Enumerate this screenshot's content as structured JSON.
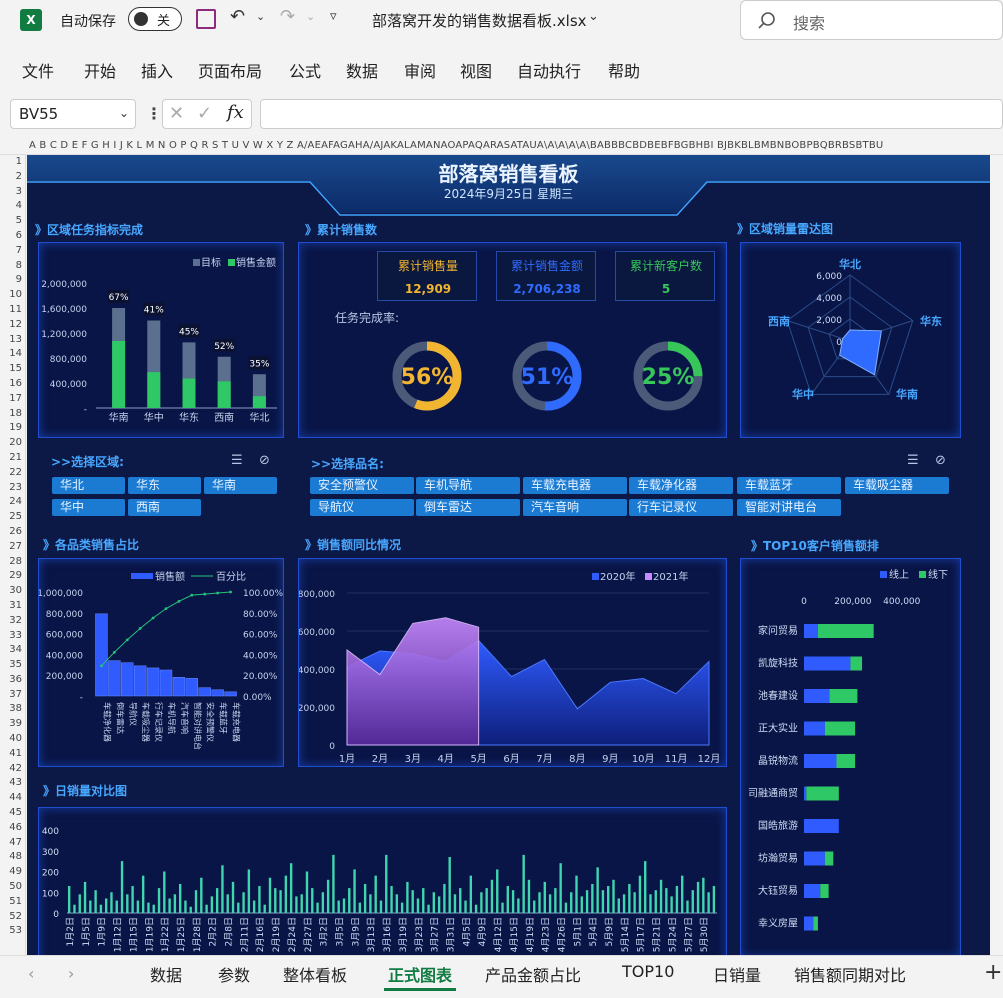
{
  "app": {
    "autosave_label": "自动保存",
    "autosave_state": "关",
    "filename": "部落窝开发的销售数据看板.xlsx",
    "search_placeholder": "搜索"
  },
  "menu": [
    "文件",
    "开始",
    "插入",
    "页面布局",
    "公式",
    "数据",
    "审阅",
    "视图",
    "自动执行",
    "帮助"
  ],
  "formula_bar": {
    "name_box": "BV55",
    "fx": "fx",
    "content": ""
  },
  "col_headers": "A B C D E F G H I J K L M N O P Q R S T U V W X Y Z A/AEAFAGAHA/AJAKALAMANAOAPAQARASATAUA\\A\\A\\A\\A\\BABBBCBDBEBFBGBHBI BJBKBLBMBNBOBPBQBRBSBTBU",
  "row_count": 53,
  "dashboard": {
    "title": "部落窝销售看板",
    "date": "2024年9月25日 星期三",
    "sections": {
      "region_task": "》区域任务指标完成",
      "cumulative": "》累计销售数",
      "radar": "》区域销量雷达图",
      "category_share": "》各品类销售占比",
      "yoy": "》销售额同比情况",
      "top10": "》TOP10客户销售额排",
      "daily": "》日销量对比图"
    },
    "kpis": [
      {
        "label": "累计销售量",
        "value": "12,909",
        "color": "#f2b531"
      },
      {
        "label": "累计销售金额",
        "value": "2,706,238",
        "color": "#2f6bff"
      },
      {
        "label": "累计新客户数",
        "value": "5",
        "color": "#36c65a"
      }
    ],
    "completion_label": "任务完成率:",
    "gauges": [
      {
        "text": "56%",
        "value": 56,
        "color": "#f2b531"
      },
      {
        "text": "51%",
        "value": 51,
        "color": "#2f6bff"
      },
      {
        "text": "25%",
        "value": 25,
        "color": "#36c65a"
      }
    ],
    "region_slicer": {
      "title": ">>选择区域:",
      "items": [
        "华北",
        "华东",
        "华南",
        "华中",
        "西南"
      ]
    },
    "product_slicer": {
      "title": ">>选择品名:",
      "items": [
        "安全预警仪",
        "车机导航",
        "车载充电器",
        "车载净化器",
        "车载蓝牙",
        "车载吸尘器",
        "导航仪",
        "倒车雷达",
        "汽车音响",
        "行车记录仪",
        "智能对讲电台"
      ]
    }
  },
  "chart_data": [
    {
      "id": "region_task",
      "type": "bar",
      "categories": [
        "华南",
        "华中",
        "华东",
        "西南",
        "华北"
      ],
      "series": [
        {
          "name": "目标",
          "values": [
            1600000,
            1400000,
            1050000,
            820000,
            540000
          ],
          "color": "#5b6f8e"
        },
        {
          "name": "销售金额",
          "values": [
            1072000,
            574000,
            472500,
            426400,
            189000
          ],
          "color": "#2ec866"
        }
      ],
      "labels": [
        "67%",
        "41%",
        "45%",
        "52%",
        "35%"
      ],
      "yticks": [
        "2,000,000",
        "1,600,000",
        "1,200,000",
        "800,000",
        "400,000",
        "-"
      ],
      "ylim": [
        0,
        2000000
      ]
    },
    {
      "id": "radar",
      "type": "radar",
      "axes": [
        "华北",
        "华东",
        "华南",
        "华中",
        "西南"
      ],
      "ticks": [
        "6,000",
        "4,000",
        "2,000",
        "0"
      ],
      "values": [
        1000,
        3000,
        3800,
        1600,
        700
      ],
      "max": 6000
    },
    {
      "id": "category_share",
      "type": "bar",
      "legend": [
        "销售额",
        "百分比"
      ],
      "categories": [
        "车载净化器",
        "倒车雷达",
        "导航仪",
        "车载吸尘器",
        "行车记录仪",
        "车机导航",
        "汽车音响",
        "智能对讲电台",
        "安全预警仪",
        "车载蓝牙",
        "车载充电器"
      ],
      "values": [
        790000,
        340000,
        320000,
        290000,
        270000,
        250000,
        180000,
        170000,
        80000,
        60000,
        40000
      ],
      "percent": [
        29,
        42,
        54,
        65,
        75,
        84,
        91,
        97,
        98,
        99,
        100
      ],
      "yticks": [
        "1,000,000",
        "800,000",
        "600,000",
        "400,000",
        "200,000",
        "-"
      ],
      "y2ticks": [
        "100.00%",
        "80.00%",
        "60.00%",
        "40.00%",
        "20.00%",
        "0.00%"
      ],
      "ylim": [
        0,
        1000000
      ]
    },
    {
      "id": "yoy",
      "type": "area",
      "categories": [
        "1月",
        "2月",
        "3月",
        "4月",
        "5月",
        "6月",
        "7月",
        "8月",
        "9月",
        "10月",
        "11月",
        "12月"
      ],
      "series": [
        {
          "name": "2020年",
          "values": [
            410000,
            495000,
            480000,
            440000,
            550000,
            360000,
            450000,
            190000,
            330000,
            350000,
            270000,
            440000
          ],
          "color": "#2f5bff"
        },
        {
          "name": "2021年",
          "values": [
            500000,
            370000,
            640000,
            670000,
            620000
          ],
          "color": "#c88aff"
        }
      ],
      "yticks": [
        "800,000",
        "600,000",
        "400,000",
        "200,000",
        "0"
      ],
      "ylim": [
        0,
        800000
      ]
    },
    {
      "id": "top10",
      "type": "bar",
      "legend": [
        "线上",
        "线下"
      ],
      "xticks": [
        "0",
        "200,000",
        "400,000"
      ],
      "categories": [
        "家问贸易",
        "凯旋科技",
        "池春建设",
        "正大实业",
        "晶锐物流",
        "司融通商贸",
        "国皓旅游",
        "坊瀚贸易",
        "大钰贸易",
        "幸义房屋"
      ],
      "series": [
        {
          "name": "线上",
          "values": [
            30000,
            100000,
            55000,
            45000,
            70000,
            5000,
            75000,
            45000,
            35000,
            20000
          ]
        },
        {
          "name": "线下",
          "values": [
            120000,
            25000,
            60000,
            65000,
            40000,
            70000,
            0,
            18000,
            18000,
            10000
          ]
        }
      ],
      "xlim": [
        0,
        450000
      ]
    },
    {
      "id": "daily",
      "type": "bar",
      "yticks": [
        "400",
        "300",
        "200",
        "100",
        "0"
      ],
      "ylim": [
        0,
        400
      ],
      "xlabels": [
        "1月2日",
        "1月5日",
        "1月9日",
        "1月12日",
        "1月15日",
        "1月19日",
        "1月22日",
        "1月25日",
        "1月28日",
        "2月2日",
        "2月8日",
        "2月11日",
        "2月16日",
        "2月19日",
        "2月24日",
        "2月27日",
        "3月2日",
        "3月5日",
        "3月9日",
        "3月13日",
        "3月16日",
        "3月19日",
        "3月23日",
        "3月27日",
        "3月31日",
        "4月5日",
        "4月9日",
        "4月12日",
        "4月15日",
        "4月19日",
        "4月23日",
        "4月26日",
        "5月1日",
        "5月4日",
        "5月9日",
        "5月14日",
        "5月17日",
        "5月21日",
        "5月24日",
        "5月27日",
        "5月30日"
      ],
      "values": [
        130,
        40,
        90,
        150,
        60,
        110,
        40,
        70,
        100,
        60,
        250,
        90,
        130,
        60,
        180,
        50,
        40,
        120,
        200,
        70,
        90,
        140,
        60,
        30,
        110,
        170,
        40,
        80,
        120,
        230,
        90,
        150,
        50,
        100,
        210,
        60,
        130,
        40,
        170,
        120,
        110,
        180,
        240,
        80,
        90,
        200,
        120,
        50,
        100,
        160,
        280,
        60,
        70,
        120,
        210,
        50,
        140,
        90,
        180,
        60,
        280,
        130,
        90,
        50,
        150,
        110,
        70,
        120,
        40,
        100,
        80,
        140,
        270,
        90,
        120,
        60,
        180,
        40,
        100,
        120,
        160,
        210,
        50,
        130,
        110,
        70,
        280,
        160,
        60,
        100,
        150,
        90,
        120,
        240,
        50,
        100,
        180,
        80,
        110,
        140,
        220,
        110,
        130,
        160,
        70,
        90,
        140,
        100,
        180,
        250,
        90,
        110,
        160,
        120,
        80,
        130,
        180,
        60,
        110,
        150,
        170,
        100,
        130
      ]
    }
  ],
  "sheet_tabs": [
    "数据",
    "参数",
    "整体看板",
    "正式图表",
    "产品金额占比",
    "TOP10",
    "日销量",
    "销售额同期对比"
  ],
  "active_tab": "正式图表"
}
